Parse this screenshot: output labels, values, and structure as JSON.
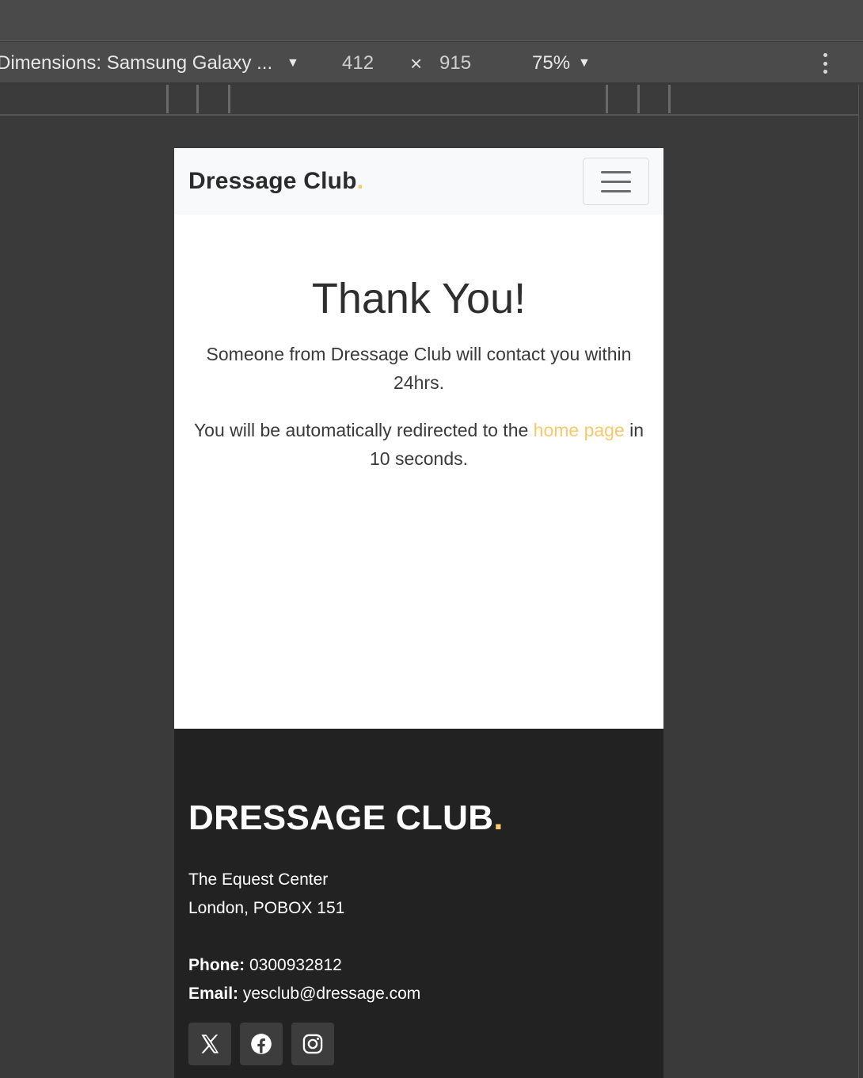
{
  "devtools": {
    "dimensions_label": "Dimensions: Samsung Galaxy ...",
    "width": "412",
    "times": "×",
    "height": "915",
    "zoom": "75%"
  },
  "navbar": {
    "brand_text": "Dressage Club",
    "brand_dot": ".",
    "toggler_icon": "hamburger-icon"
  },
  "main": {
    "title": "Thank You!",
    "message": "Someone from Dressage Club will contact you within 24hrs.",
    "redirect_before": "You will be automatically redirected to the ",
    "redirect_link": "home page",
    "redirect_after": " in 10 seconds."
  },
  "footer": {
    "brand_text": "DRESSAGE CLUB",
    "brand_dot": ".",
    "address_line1": "The Equest Center",
    "address_line2": "London, POBOX 151",
    "phone_label": "Phone:",
    "phone_value": " 0300932812",
    "email_label": "Email:",
    "email_value": " yesclub@dressage.com",
    "social_icons": [
      "x-twitter-icon",
      "facebook-icon",
      "instagram-icon"
    ]
  },
  "colors": {
    "accent": "#f7c96a",
    "navbar_bg": "#f8f9fa",
    "footer_bg": "#222222"
  }
}
